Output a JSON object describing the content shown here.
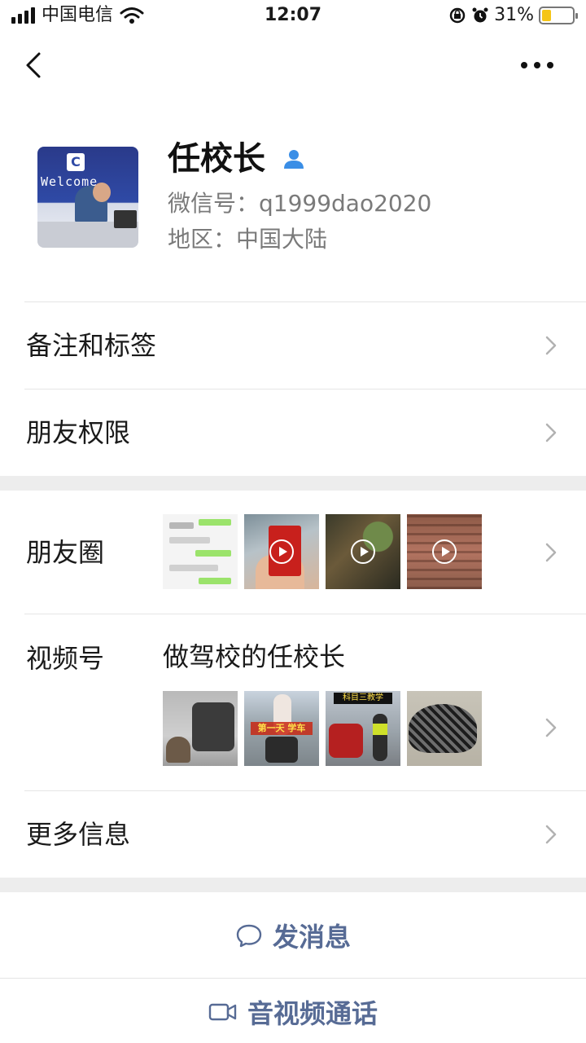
{
  "status_bar": {
    "carrier": "中国电信",
    "time": "12:07",
    "battery_percent": "31%",
    "battery_level": 0.31,
    "battery_color": "#f5c518"
  },
  "nav": {
    "back_icon": "chevron-left-icon",
    "more_icon": "more-dots-icon"
  },
  "profile": {
    "name": "任校长",
    "wechat_id": "微信号：q1999dao2020",
    "region": "地区：中国大陆",
    "avatar_text": "Welcome"
  },
  "menu": {
    "remark_tags": "备注和标签",
    "friend_permissions": "朋友权限",
    "moments": "朋友圈",
    "channels": "视频号",
    "channels_name": "做驾校的任校长",
    "more_info": "更多信息"
  },
  "channels_thumbs": {
    "v2_caption": "第一天 学车",
    "v3_caption": "科目三教学"
  },
  "actions": {
    "send_message": "发消息",
    "av_call": "音视频通话",
    "accent_color": "#576b95"
  }
}
